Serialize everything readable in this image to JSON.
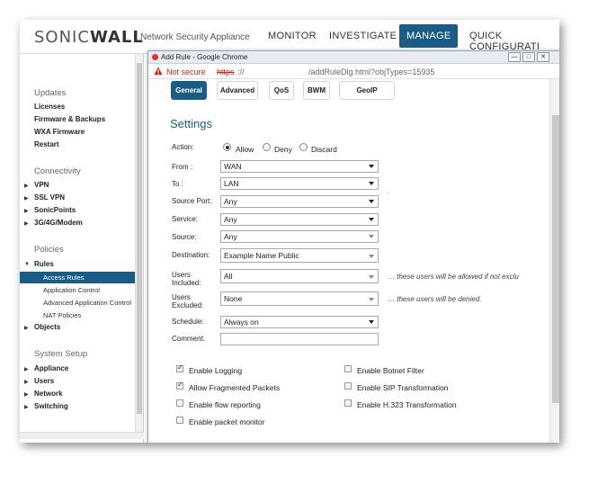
{
  "app": {
    "logo_part1": "SONIC",
    "logo_part2": "WALL",
    "product": "Network Security Appliance",
    "nav": [
      {
        "label": "MONITOR"
      },
      {
        "label": "INVESTIGATE"
      },
      {
        "label": "MANAGE"
      },
      {
        "label": "QUICK CONFIGURATI"
      }
    ],
    "accent": "#1a5c86"
  },
  "sidebar": {
    "updates_head": "Updates",
    "updates": [
      "Licenses",
      "Firmware & Backups",
      "WXA Firmware",
      "Restart"
    ],
    "connectivity_head": "Connectivity",
    "connectivity": [
      "VPN",
      "SSL VPN",
      "SonicPoints",
      "3G/4G/Modem"
    ],
    "policies_head": "Policies",
    "rules": "Rules",
    "rules_sub": [
      "Access Rules",
      "Application Control",
      "Advanced Application Control",
      "NAT Policies"
    ],
    "objects": "Objects",
    "system_head": "System Setup",
    "system": [
      "Appliance",
      "Users",
      "Network",
      "Switching"
    ]
  },
  "popup": {
    "window_title": "Add Rule - Google Chrome",
    "not_secure": "Not secure",
    "https": "https",
    "https_rest": "://",
    "path": "/addRuleDlg.html?objTypes=15935",
    "tabs": [
      "General",
      "Advanced",
      "QoS",
      "BWM",
      "GeoIP"
    ],
    "settings_title": "Settings",
    "action": {
      "label": "Action:",
      "options": [
        "Allow",
        "Deny",
        "Discard"
      ],
      "selected": "Allow"
    },
    "fields": {
      "from": {
        "label": "From :",
        "value": "WAN"
      },
      "to": {
        "label": "To :",
        "value": "LAN"
      },
      "source_port": {
        "label": "Source Port:",
        "value": "Any"
      },
      "service": {
        "label": "Service:",
        "value": "Any"
      },
      "source": {
        "label": "Source:",
        "value": "Any"
      },
      "destination": {
        "label": "Destination:",
        "value": "Example Name Public"
      },
      "users_included": {
        "label1": "Users",
        "label2": "Included:",
        "value": "All",
        "note": "… these users will be allowed if not exclu"
      },
      "users_excluded": {
        "label1": "Users",
        "label2": "Excluded:",
        "value": "None",
        "note": "… these users will be denied."
      },
      "schedule": {
        "label": "Schedule:",
        "value": "Always on"
      },
      "comment": {
        "label": "Comment:",
        "value": ""
      }
    },
    "checkboxes_left": [
      {
        "label": "Enable Logging",
        "checked": true
      },
      {
        "label": "Allow Fragmented Packets",
        "checked": true
      },
      {
        "label": "Enable flow reporting",
        "checked": false
      },
      {
        "label": "Enable packet monitor",
        "checked": false
      }
    ],
    "checkboxes_right": [
      {
        "label": "Enable Botnet Filter",
        "checked": false
      },
      {
        "label": "Enable SIP Transformation",
        "checked": false
      },
      {
        "label": "Enable H.323 Transformation",
        "checked": false
      }
    ]
  }
}
